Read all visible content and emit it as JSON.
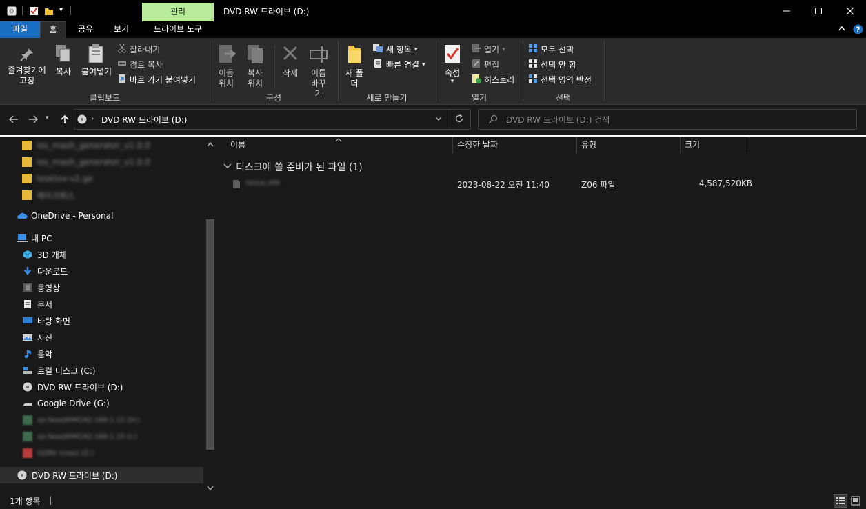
{
  "titlebar": {
    "manage_tab": "관리",
    "window_title": "DVD RW 드라이브 (D:)"
  },
  "tabs": [
    "파일",
    "홈",
    "공유",
    "보기",
    "드라이브 도구"
  ],
  "ribbon": {
    "clipboard": {
      "pin_label": "즐겨찾기에 고정",
      "copy_label": "복사",
      "paste_label": "붙여넣기",
      "cut_label": "잘라내기",
      "copy_path_label": "경로 복사",
      "paste_shortcut_label": "바로 가기 붙여넣기",
      "group_label": "클립보드"
    },
    "organize": {
      "move_to_label": "이동 위치",
      "copy_to_label": "복사 위치",
      "delete_label": "삭제",
      "rename_label": "이름 바꾸기",
      "group_label": "구성"
    },
    "new": {
      "new_folder_label": "새 폴더",
      "new_item_label": "새 항목",
      "easy_access_label": "빠른 연결",
      "group_label": "새로 만들기"
    },
    "open": {
      "properties_label": "속성",
      "open_label": "열기",
      "edit_label": "편집",
      "history_label": "히스토리",
      "group_label": "열기"
    },
    "select": {
      "select_all_label": "모두 선택",
      "select_none_label": "선택 안 함",
      "invert_label": "선택 영역 반전",
      "group_label": "선택"
    }
  },
  "address": {
    "path": "DVD RW 드라이브 (D:)",
    "search_placeholder": "DVD RW 드라이브 (D:) 검색"
  },
  "nav": {
    "blurred_top": [
      "ios_mash_generator_v1.0.0",
      "ios_mash_generator_v1.0.0",
      "tesktov-v2.ge",
      "제이크뤼스"
    ],
    "onedrive": "OneDrive - Personal",
    "this_pc": "내 PC",
    "items": [
      "3D 개체",
      "다운로드",
      "동영상",
      "문서",
      "바탕 화면",
      "사진",
      "음악",
      "로컬 디스크 (C:)",
      "DVD RW 드라이브 (D:)",
      "Google Drive (G:)"
    ],
    "blurred_bottom": [
      "qs-fwas9HM192.168.1.12 (H:)",
      "qs-fwas9HM192.168.1.15 (I:)",
      "GDRV (\\nas) (Z:)"
    ],
    "selected": "DVD RW 드라이브 (D:)"
  },
  "columns": [
    "이름",
    "수정한 날짜",
    "유형",
    "크기"
  ],
  "group_header": "디스크에 쓸 준비가 된 파일 (1)",
  "files": [
    {
      "name": "teous.z06",
      "date": "2023-08-22 오전 11:40",
      "type": "Z06 파일",
      "size": "4,587,520KB"
    }
  ],
  "status": {
    "count": "1개 항목"
  },
  "colors": {
    "accent": "#1a6fc4",
    "manage_tab": "#b8ec9a",
    "background": "#191919",
    "ribbon": "#2b2b2b"
  }
}
